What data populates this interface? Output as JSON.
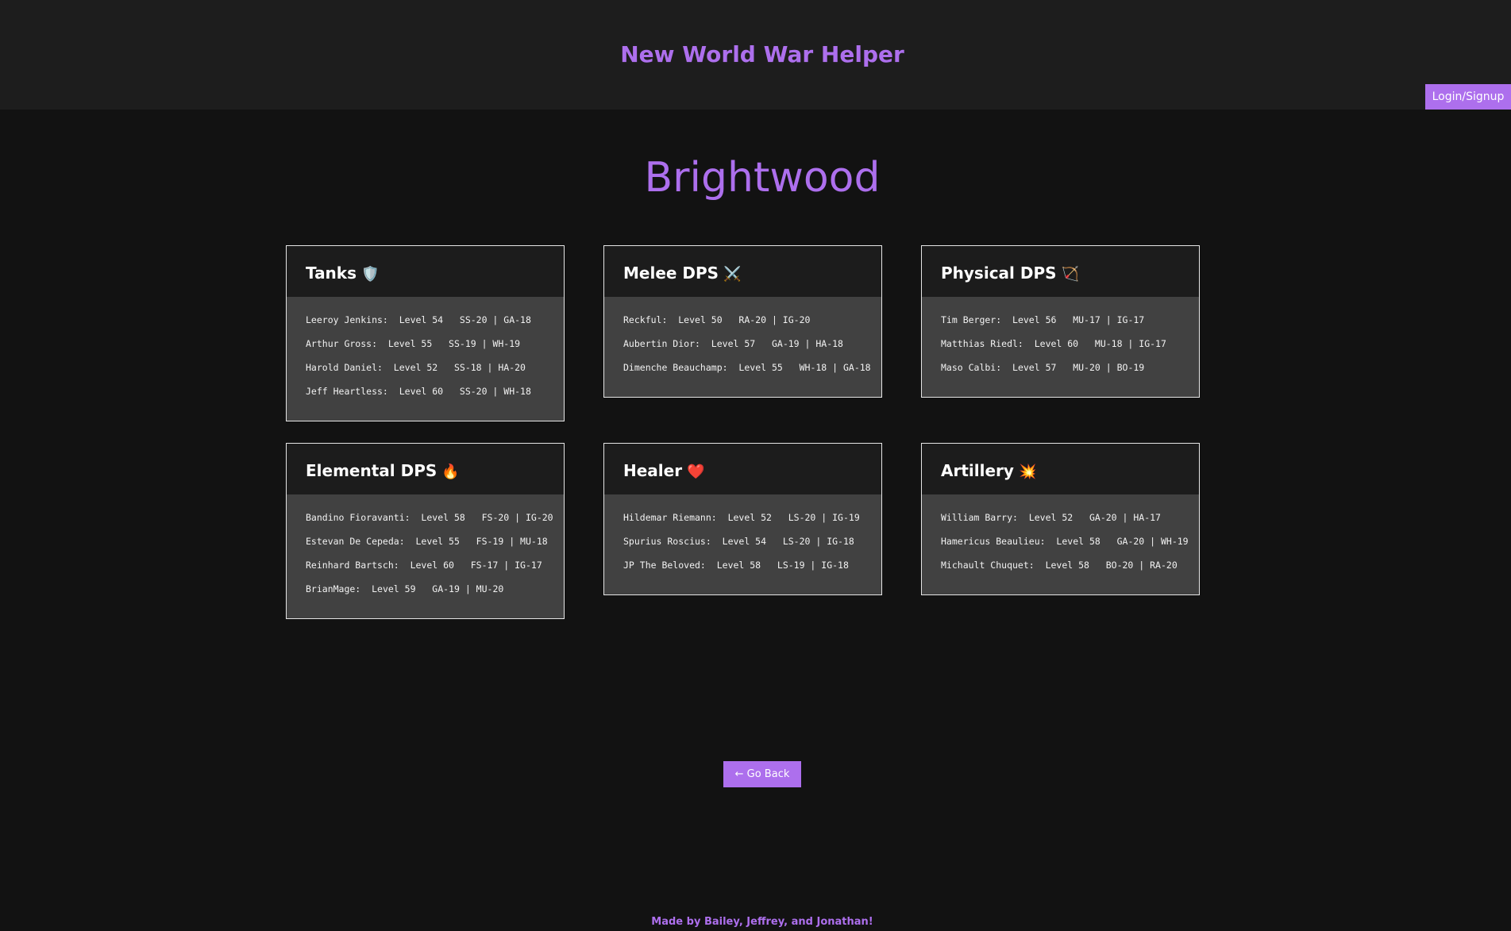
{
  "header": {
    "title": "New World War Helper",
    "login_label": "Login/Signup"
  },
  "page": {
    "heading": "Brightwood"
  },
  "roles": [
    {
      "title": "Tanks",
      "icon": "🛡️",
      "icon_name": "shield-icon",
      "players": [
        {
          "name": "Leeroy Jenkins:",
          "level": "Level 54",
          "weapons": "SS-20 | GA-18"
        },
        {
          "name": "Arthur Gross:",
          "level": "Level 55",
          "weapons": "SS-19 | WH-19"
        },
        {
          "name": "Harold Daniel:",
          "level": "Level 52",
          "weapons": "SS-18 | HA-20"
        },
        {
          "name": "Jeff Heartless:",
          "level": "Level 60",
          "weapons": "SS-20 | WH-18"
        }
      ]
    },
    {
      "title": "Melee DPS",
      "icon": "⚔️",
      "icon_name": "crossed-swords-icon",
      "players": [
        {
          "name": "Reckful:",
          "level": "Level 50",
          "weapons": "RA-20 | IG-20"
        },
        {
          "name": "Aubertin Dior:",
          "level": "Level 57",
          "weapons": "GA-19 | HA-18"
        },
        {
          "name": "Dimenche Beauchamp:",
          "level": "Level 55",
          "weapons": "WH-18 | GA-18"
        }
      ]
    },
    {
      "title": "Physical DPS",
      "icon": "🏹",
      "icon_name": "bow-and-arrow-icon",
      "players": [
        {
          "name": "Tim Berger:",
          "level": "Level 56",
          "weapons": "MU-17 | IG-17"
        },
        {
          "name": "Matthias Riedl:",
          "level": "Level 60",
          "weapons": "MU-18 | IG-17"
        },
        {
          "name": "Maso Calbi:",
          "level": "Level 57",
          "weapons": "MU-20 | BO-19"
        }
      ]
    },
    {
      "title": "Elemental DPS",
      "icon": "🔥",
      "icon_name": "fire-icon",
      "players": [
        {
          "name": "Bandino Fioravanti:",
          "level": "Level 58",
          "weapons": "FS-20 | IG-20"
        },
        {
          "name": "Estevan De Cepeda:",
          "level": "Level 55",
          "weapons": "FS-19 | MU-18"
        },
        {
          "name": "Reinhard Bartsch:",
          "level": "Level 60",
          "weapons": "FS-17 | IG-17"
        },
        {
          "name": "BrianMage:",
          "level": "Level 59",
          "weapons": "GA-19 | MU-20"
        }
      ]
    },
    {
      "title": "Healer",
      "icon": "❤️",
      "icon_name": "heart-icon",
      "players": [
        {
          "name": "Hildemar Riemann:",
          "level": "Level 52",
          "weapons": "LS-20 | IG-19"
        },
        {
          "name": "Spurius Roscius:",
          "level": "Level 54",
          "weapons": "LS-20 | IG-18"
        },
        {
          "name": "JP The Beloved:",
          "level": "Level 58",
          "weapons": "LS-19 | IG-18"
        }
      ]
    },
    {
      "title": "Artillery",
      "icon": "💥",
      "icon_name": "explosion-icon",
      "players": [
        {
          "name": "William Barry:",
          "level": "Level 52",
          "weapons": "GA-20 | HA-17"
        },
        {
          "name": "Hamericus Beaulieu:",
          "level": "Level 58",
          "weapons": "GA-20 | WH-19"
        },
        {
          "name": "Michault Chuquet:",
          "level": "Level 58",
          "weapons": "BO-20 | RA-20"
        }
      ]
    }
  ],
  "nav": {
    "go_back_label": "← Go Back"
  },
  "footer": {
    "text": "Made by Bailey, Jeffrey, and Jonathan!"
  },
  "colors": {
    "accent": "#ad6fed",
    "background": "#121212",
    "header_bg": "#1d1d1d",
    "card_head_bg": "#1c1c1c",
    "card_body_bg": "#414141"
  }
}
